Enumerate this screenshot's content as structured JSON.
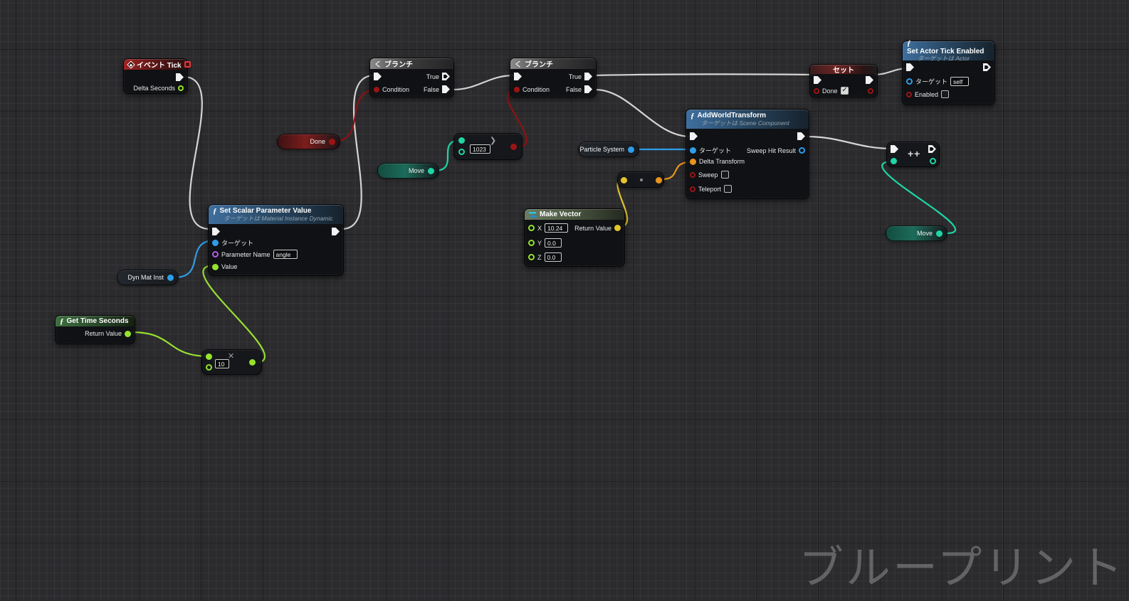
{
  "colors": {
    "pin_bool": "#9b1515",
    "pin_float": "#95e32c",
    "pin_int": "#1fd6a5",
    "pin_object": "#2f9ee8",
    "pin_vector": "#e5c52b",
    "pin_transform": "#e8941e",
    "pin_name": "#b45fe0",
    "wire_exec": "#d4d4d4",
    "wire_bool": "#8e1212",
    "wire_float": "#97e032",
    "wire_int": "#1ed6a4",
    "wire_object": "#2f9ee8",
    "wire_vector": "#e3c229",
    "wire_transform": "#e8941e"
  },
  "icons": {
    "branch": "く",
    "multiply": "✕",
    "greater": "❯",
    "increment": "++",
    "conv_dot": ""
  },
  "nodes": {
    "event_tick": {
      "title": "イベント Tick",
      "delta_label": "Delta Seconds"
    },
    "branch1": {
      "title": "ブランチ",
      "condition_label": "Condition",
      "true_label": "True",
      "false_label": "False"
    },
    "branch2": {
      "title": "ブランチ",
      "condition_label": "Condition",
      "true_label": "True",
      "false_label": "False"
    },
    "set_scalar": {
      "title": "Set Scalar Parameter Value",
      "subtitle": "ターゲットは Material Instance Dynamic",
      "target_label": "ターゲット",
      "param_label": "Parameter Name",
      "param_value": "angle",
      "value_label": "Value"
    },
    "get_time": {
      "title": "Get Time Seconds",
      "return_label": "Return Value"
    },
    "multiply": {
      "operator": "✕",
      "b_value": "10"
    },
    "greater": {
      "operator": "❯",
      "b_value": "1023"
    },
    "add_world_transform": {
      "title": "AddWorldTransform",
      "subtitle": "ターゲットは Scene Component",
      "target_label": "ターゲット",
      "sweep_hit_label": "Sweep Hit Result",
      "delta_label": "Delta Transform",
      "sweep_label": "Sweep",
      "teleport_label": "Teleport"
    },
    "make_vector": {
      "title": "Make Vector",
      "x_label": "X",
      "x_value": "10.24",
      "y_label": "Y",
      "y_value": "0.0",
      "z_label": "Z",
      "z_value": "0.0",
      "return_label": "Return Value"
    },
    "set_done": {
      "title": "セット",
      "var_label": "Done"
    },
    "set_actor_tick": {
      "title": "Set Actor Tick Enabled",
      "subtitle": "ターゲットは Actor",
      "target_label": "ターゲット",
      "target_value": "self",
      "enabled_label": "Enabled"
    },
    "increment": {
      "operator": "++"
    }
  },
  "pills": {
    "done": {
      "label": "Done"
    },
    "move_mid": {
      "label": "Move"
    },
    "move_right": {
      "label": "Move"
    },
    "dyn_mat_inst": {
      "label": "Dyn Mat Inst"
    },
    "particle_system": {
      "label": "Particle System"
    }
  },
  "watermark": "ブループリント"
}
